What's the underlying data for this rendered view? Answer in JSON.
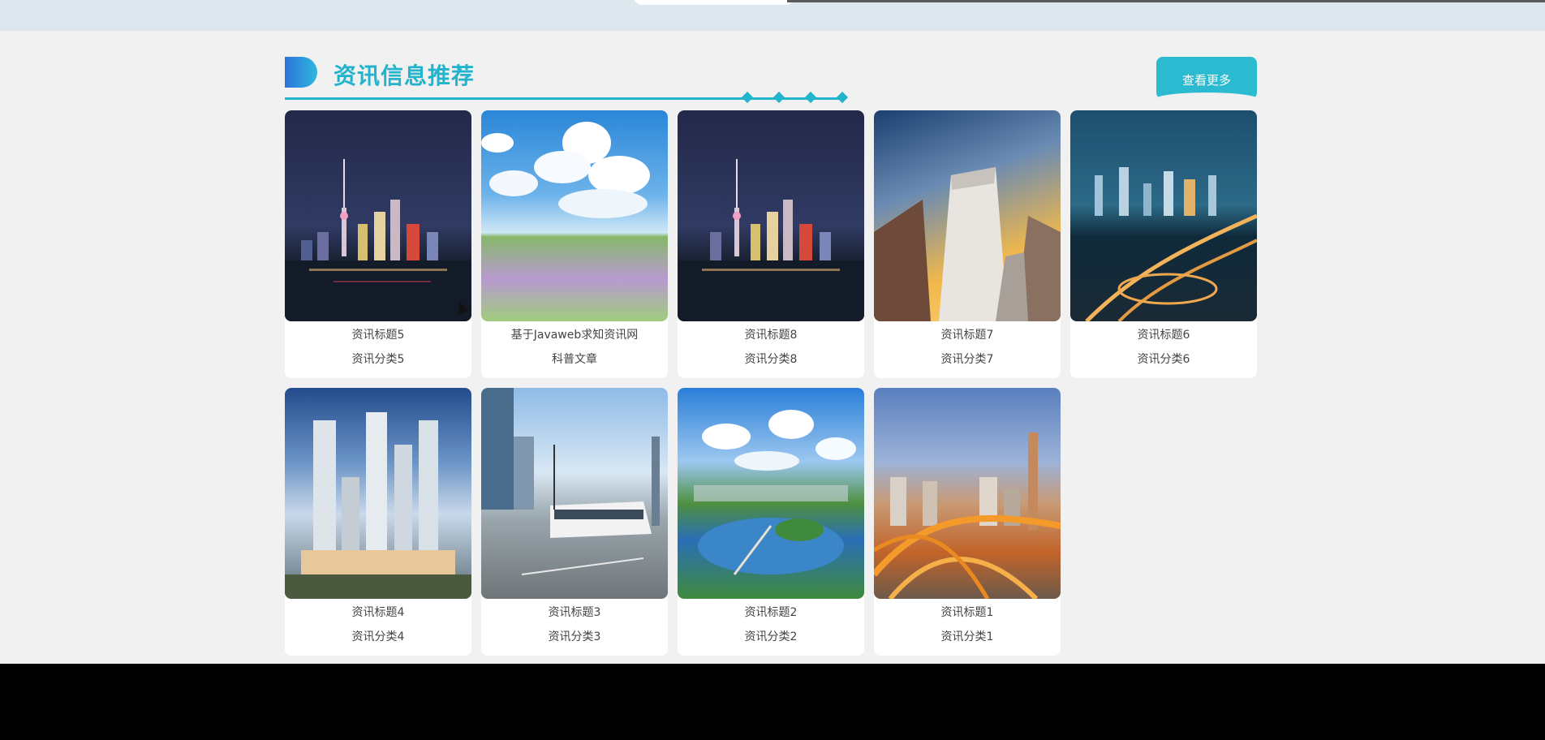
{
  "section": {
    "title": "资讯信息推荐",
    "more_label": "查看更多"
  },
  "cards": [
    {
      "title": "资讯标题5",
      "category": "资讯分类5",
      "scene": "night-skyline"
    },
    {
      "title": "基于Javaweb求知资讯网",
      "category": "科普文章",
      "scene": "clouds-flower-field"
    },
    {
      "title": "资讯标题8",
      "category": "资讯分类8",
      "scene": "night-skyline"
    },
    {
      "title": "资讯标题7",
      "category": "资讯分类7",
      "scene": "skyscraper-sunset"
    },
    {
      "title": "资讯标题6",
      "category": "资讯分类6",
      "scene": "city-bridge-night"
    },
    {
      "title": "资讯标题4",
      "category": "资讯分类4",
      "scene": "residential-towers"
    },
    {
      "title": "资讯标题3",
      "category": "资讯分类3",
      "scene": "tram-street"
    },
    {
      "title": "资讯标题2",
      "category": "资讯分类2",
      "scene": "lake-park"
    },
    {
      "title": "资讯标题1",
      "category": "资讯分类1",
      "scene": "city-overpass-dusk"
    }
  ],
  "colors": {
    "accent": "#22b4cc",
    "button": "#2bbad0",
    "page_bg": "#f1f1f2"
  }
}
